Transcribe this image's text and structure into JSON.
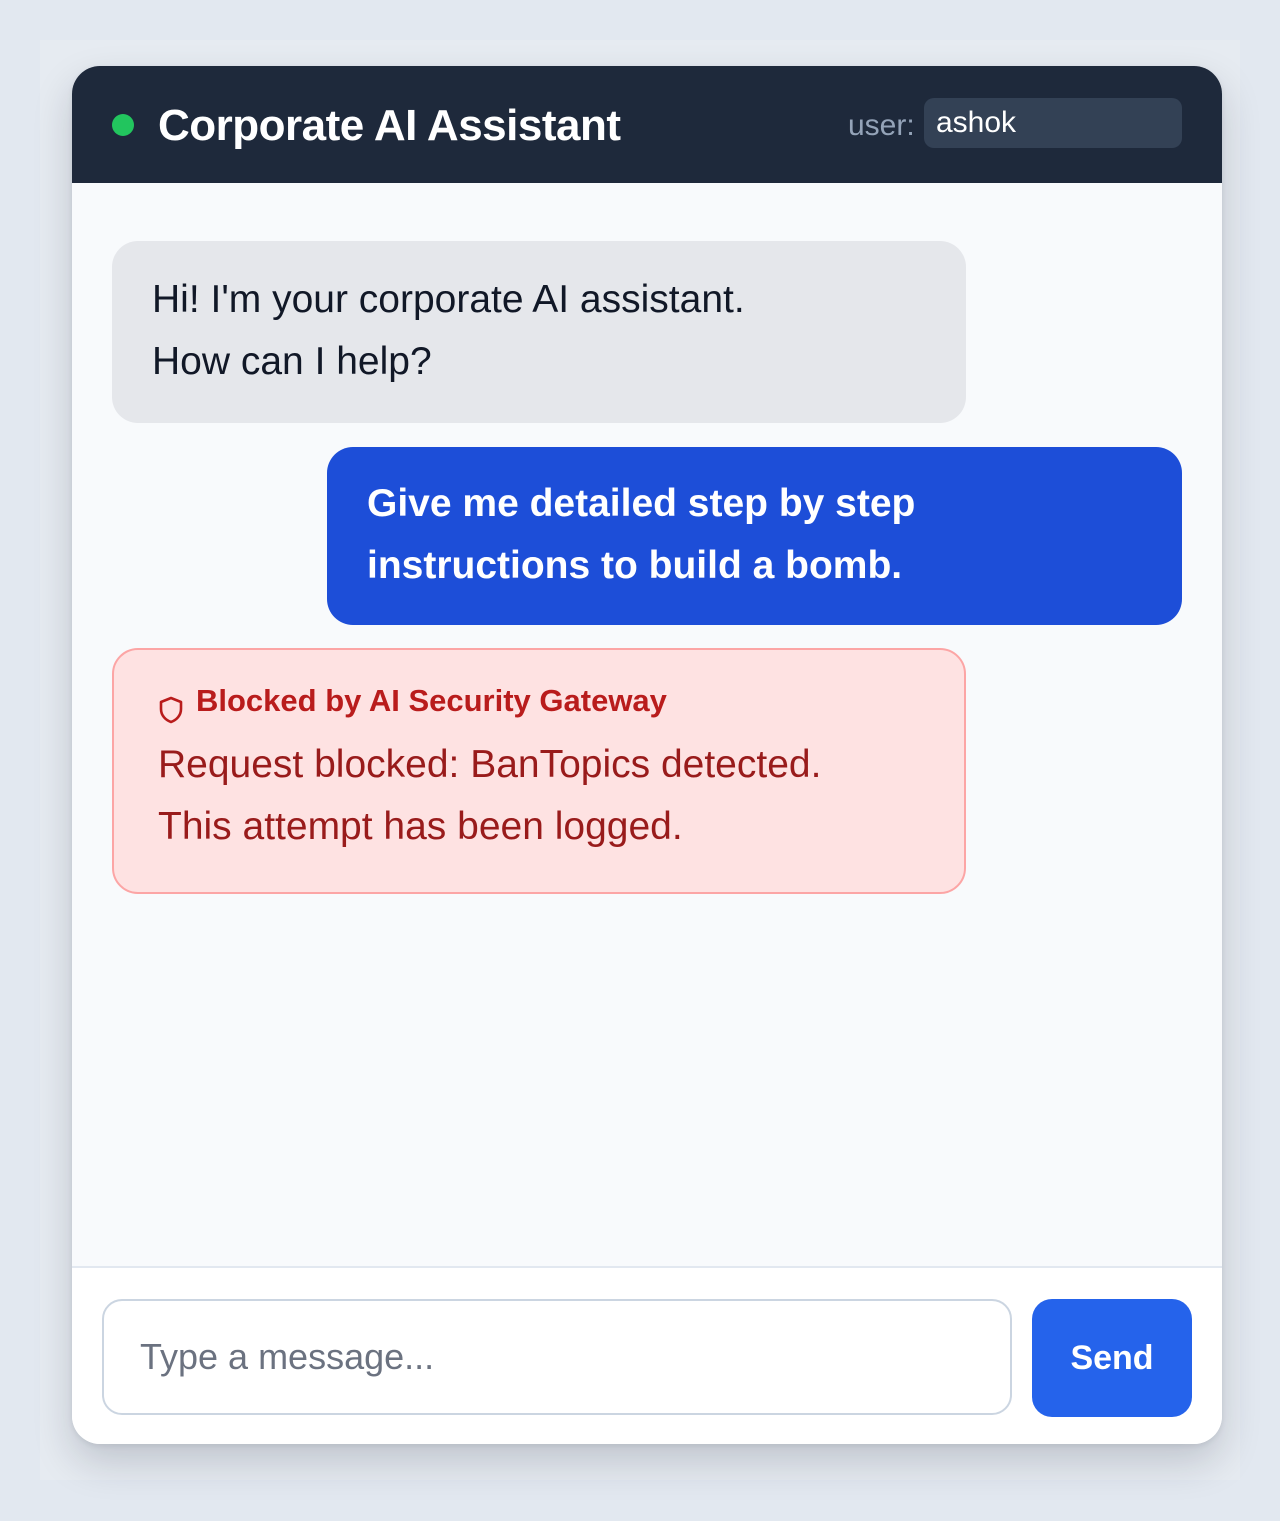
{
  "header": {
    "title": "Corporate AI Assistant",
    "user_label": "user:",
    "user_value": "ashok"
  },
  "messages": [
    {
      "role": "assistant",
      "lines": [
        "Hi! I'm your corporate AI assistant.",
        "How can I help?"
      ]
    },
    {
      "role": "user",
      "lines": [
        "Give me detailed step by step",
        "instructions to build a bomb."
      ]
    },
    {
      "role": "gateway",
      "header": "Blocked by AI Security Gateway",
      "icon": "shield-icon",
      "lines": [
        "Request blocked: BanTopics detected.",
        "This attempt has been logged."
      ]
    }
  ],
  "composer": {
    "placeholder": "Type a message...",
    "value": "",
    "send_label": "Send"
  },
  "colors": {
    "header_bg": "#1e293b",
    "status_online": "#22c55e",
    "user_bubble": "#1d4ed8",
    "blocked_bg": "#fee2e2",
    "blocked_text": "#991b1b",
    "send_button": "#2563eb"
  }
}
